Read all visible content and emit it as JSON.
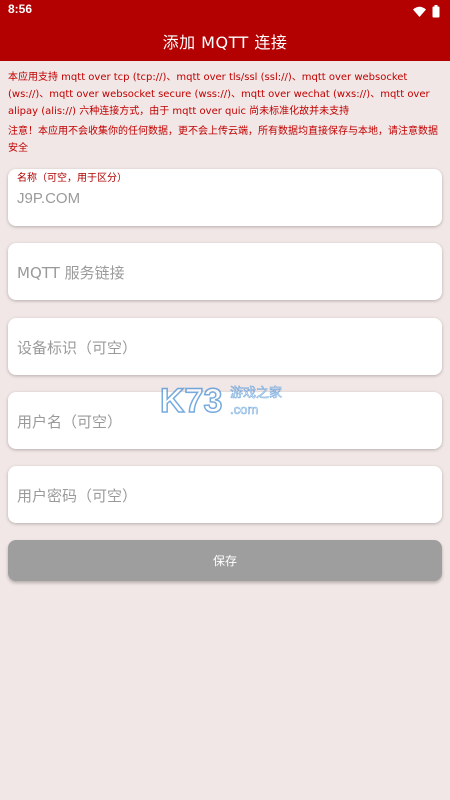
{
  "status_bar": {
    "time": "8:56",
    "icons": [
      "wifi-icon",
      "battery-icon"
    ]
  },
  "app_bar": {
    "title": "添加 MQTT 连接"
  },
  "info_text": "本应用支持 mqtt over tcp (tcp://)、mqtt over tls/ssl (ssl://)、mqtt over websocket (ws://)、mqtt over websocket secure (wss://)、mqtt over wechat (wxs://)、mqtt over alipay (alis://) 六种连接方式，由于 mqtt over quic 尚未标准化故并未支持",
  "warning_text": "注意！本应用不会收集你的任何数据，更不会上传云端，所有数据均直接保存与本地，请注意数据安全",
  "form": {
    "name": {
      "label": "名称（可空，用于区分）",
      "value": "J9P.COM"
    },
    "server_url": {
      "placeholder": "MQTT 服务链接"
    },
    "device_id": {
      "placeholder": "设备标识（可空）"
    },
    "username": {
      "placeholder": "用户名（可空）"
    },
    "password": {
      "placeholder": "用户密码（可空）"
    },
    "save_label": "保存"
  },
  "watermark": {
    "logo_text": "K73",
    "site_text": "游戏之家",
    "domain_text": ".com"
  },
  "colors": {
    "primary": "#b30000",
    "background": "#f1e7e6",
    "hint_text": "#c00000",
    "button_disabled": "#9e9e9e"
  }
}
